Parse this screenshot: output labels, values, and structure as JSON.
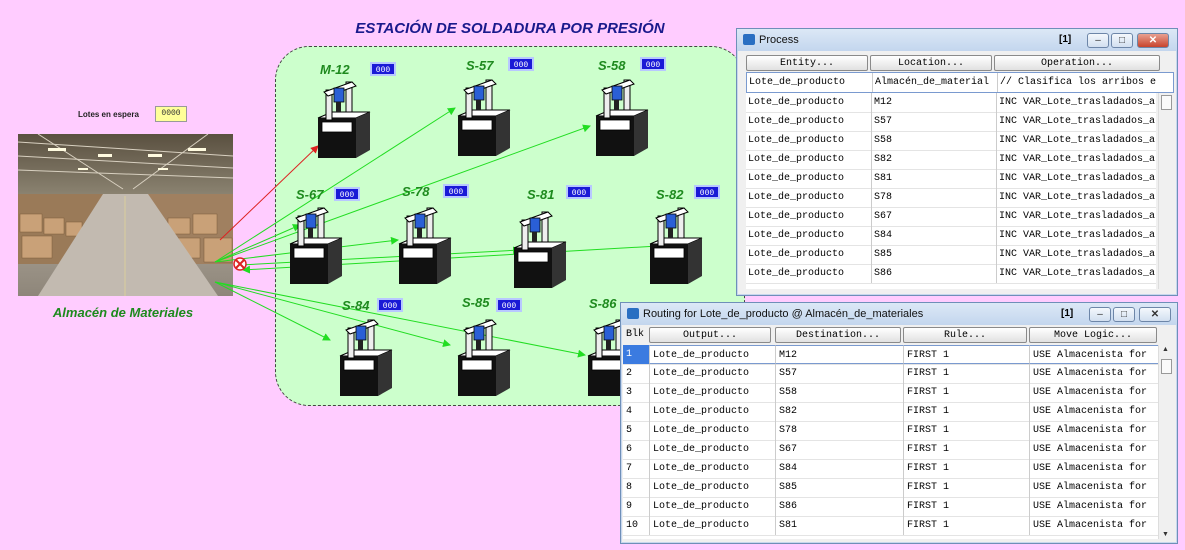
{
  "title": "ESTACIÓN DE SOLDADURA POR PRESIÓN",
  "lotes_en_espera": {
    "label": "Lotes en espera",
    "value": "0000"
  },
  "warehouse_label": "Almacén de Materiales",
  "machines": [
    {
      "name": "M-12",
      "counter": "000"
    },
    {
      "name": "S-57",
      "counter": "000"
    },
    {
      "name": "S-58",
      "counter": "000"
    },
    {
      "name": "S-67",
      "counter": "000"
    },
    {
      "name": "S-78",
      "counter": "000"
    },
    {
      "name": "S-81",
      "counter": "000"
    },
    {
      "name": "S-82",
      "counter": "000"
    },
    {
      "name": "S-84",
      "counter": "000"
    },
    {
      "name": "S-85",
      "counter": "000"
    },
    {
      "name": "S-86",
      "counter": "000"
    }
  ],
  "process_window": {
    "title": "Process",
    "num": "[1]",
    "headers": [
      "Entity...",
      "Location...",
      "Operation..."
    ],
    "top_row": [
      "Lote_de_producto",
      "Almacén_de_material",
      "// Clasifica los arribos e"
    ],
    "rows": [
      [
        "Lote_de_producto",
        "M12",
        "INC VAR_Lote_trasladados_a"
      ],
      [
        "Lote_de_producto",
        "S57",
        "INC VAR_Lote_trasladados_a"
      ],
      [
        "Lote_de_producto",
        "S58",
        "INC VAR_Lote_trasladados_a"
      ],
      [
        "Lote_de_producto",
        "S82",
        "INC VAR_Lote_trasladados_a"
      ],
      [
        "Lote_de_producto",
        "S81",
        "INC VAR_Lote_trasladados_a"
      ],
      [
        "Lote_de_producto",
        "S78",
        "INC VAR_Lote_trasladados_a"
      ],
      [
        "Lote_de_producto",
        "S67",
        "INC VAR_Lote_trasladados_a"
      ],
      [
        "Lote_de_producto",
        "S84",
        "INC VAR_Lote_trasladados_a"
      ],
      [
        "Lote_de_producto",
        "S85",
        "INC VAR_Lote_trasladados_a"
      ],
      [
        "Lote_de_producto",
        "S86",
        "INC VAR_Lote_trasladados_a"
      ]
    ]
  },
  "routing_window": {
    "title": "Routing for Lote_de_producto @ Almacén_de_materiales",
    "num": "[1]",
    "blk_header": "Blk",
    "headers": [
      "Output...",
      "Destination...",
      "Rule...",
      "Move Logic..."
    ],
    "rows": [
      [
        "1",
        "Lote_de_producto",
        "M12",
        "FIRST 1",
        "USE Almacenista for"
      ],
      [
        "2",
        "Lote_de_producto",
        "S57",
        "FIRST 1",
        "USE Almacenista for"
      ],
      [
        "3",
        "Lote_de_producto",
        "S58",
        "FIRST 1",
        "USE Almacenista for"
      ],
      [
        "4",
        "Lote_de_producto",
        "S82",
        "FIRST 1",
        "USE Almacenista for"
      ],
      [
        "5",
        "Lote_de_producto",
        "S78",
        "FIRST 1",
        "USE Almacenista for"
      ],
      [
        "6",
        "Lote_de_producto",
        "S67",
        "FIRST 1",
        "USE Almacenista for"
      ],
      [
        "7",
        "Lote_de_producto",
        "S84",
        "FIRST 1",
        "USE Almacenista for"
      ],
      [
        "8",
        "Lote_de_producto",
        "S85",
        "FIRST 1",
        "USE Almacenista for"
      ],
      [
        "9",
        "Lote_de_producto",
        "S86",
        "FIRST 1",
        "USE Almacenista for"
      ],
      [
        "10",
        "Lote_de_producto",
        "S81",
        "FIRST 1",
        "USE Almacenista for"
      ]
    ]
  },
  "colors": {
    "background": "#ffccff",
    "station": "#ccffcc",
    "arrow_green": "#22dd22",
    "arrow_red": "#dd2222",
    "counter_bg": "#1a1ad6"
  }
}
